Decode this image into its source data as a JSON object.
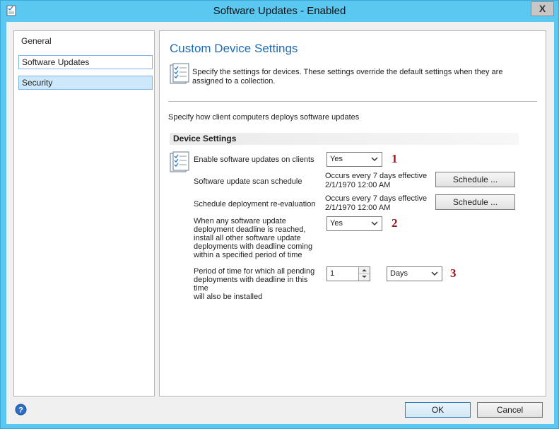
{
  "window": {
    "title": "Software Updates - Enabled",
    "close_label": "X"
  },
  "nav": {
    "items": [
      {
        "label": "General"
      },
      {
        "label": "Software Updates"
      },
      {
        "label": "Security"
      }
    ],
    "selected": "Security"
  },
  "page": {
    "heading": "Custom Device Settings",
    "description": "Specify the settings for devices. These settings override the default settings when they are assigned to a collection.",
    "instruction": "Specify how client computers deploys software updates",
    "section_title": "Device Settings"
  },
  "settings": {
    "enable_label": "Enable software updates on clients",
    "enable_value": "Yes",
    "scan_label": "Software update scan schedule",
    "scan_schedule_line1": "Occurs every 7 days effective",
    "scan_schedule_line2": "2/1/1970 12:00 AM",
    "scan_button": "Schedule ...",
    "reeval_label": "Schedule deployment re-evaluation",
    "reeval_schedule_line1": "Occurs every 7 days effective",
    "reeval_schedule_line2": "2/1/1970 12:00 AM",
    "reeval_button": "Schedule ...",
    "deadline_label_lines": [
      "When any software update",
      "deployment deadline is reached,",
      "install all other software update",
      "deployments with deadline coming",
      "within a specified period of time"
    ],
    "deadline_value": "Yes",
    "period_label_lines": [
      "Period of time for which all pending",
      "deployments with deadline in this time",
      "will also be installed"
    ],
    "period_value": "1",
    "period_unit": "Days"
  },
  "annotations": {
    "one": "1",
    "two": "2",
    "three": "3"
  },
  "footer": {
    "ok_label": "OK",
    "cancel_label": "Cancel"
  },
  "icons": {
    "app": "settings-document-icon",
    "help": "help-icon",
    "close": "close-icon",
    "dropdown": "chevron-down-icon"
  },
  "colors": {
    "window_frame": "#5ac8f0",
    "heading": "#1c6bb3",
    "selection": "#cde8fa",
    "annotation": "#a0131c"
  }
}
